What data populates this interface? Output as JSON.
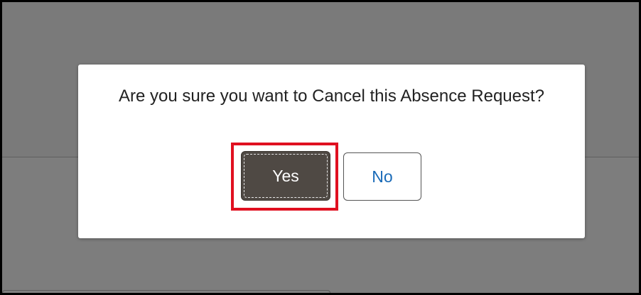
{
  "dialog": {
    "message": "Are you sure you want to Cancel this Absence Request?",
    "yes_label": "Yes",
    "no_label": "No"
  },
  "colors": {
    "overlay": "#7a7a7a",
    "primary_button": "#4f4944",
    "secondary_text": "#1a6bb8",
    "highlight": "#e01020"
  }
}
